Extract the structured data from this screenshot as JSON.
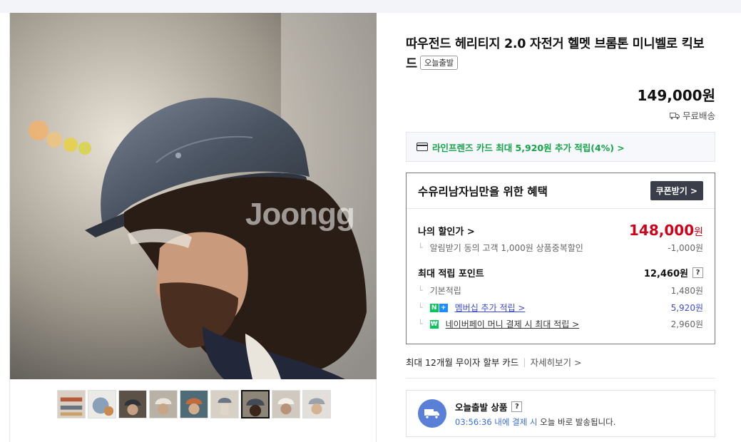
{
  "product": {
    "title": "따우전드 헤리티지 2.0 자전거 헬멧 브롬톤 미니벨로 킥보드",
    "badge": "오늘출발",
    "price": "149,000원",
    "shipping": "무료배송",
    "watermark": "Joongg"
  },
  "card_promo": {
    "text": "라인프렌즈 카드 최대 5,920원 추가 적립(4%) >"
  },
  "benefit": {
    "title": "수유리남자님만을 위한 혜택",
    "coupon_button": "쿠폰받기 >",
    "my_price_label": "나의 할인가 >",
    "my_price_value": "148,000",
    "won": "원",
    "coupon_desc": "알림받기 동의 고객 1,000원 상품중복할인",
    "coupon_amount": "-1,000원",
    "points_label": "최대 적립 포인트",
    "points_value": "12,460원",
    "help": "?",
    "base_label": "기본적립",
    "base_value": "1,480원",
    "membership_label": "멤버십 추가 적립 >",
    "membership_value": "5,920원",
    "npay_label": "네이버페이 머니 결제 시 최대 적립 >",
    "npay_value": "2,960원",
    "corner": "└"
  },
  "installment": {
    "text": "최대 12개월 무이자 할부 카드",
    "sep": "|",
    "more": "자세히보기 >"
  },
  "today_ship": {
    "title": "오늘출발 상품",
    "help": "?",
    "time": "03:56:36 내에 결제 시",
    "desc": " 오늘 바로 발송됩니다."
  },
  "thumbnails": [
    "thumb-1",
    "thumb-2",
    "thumb-3",
    "thumb-4",
    "thumb-5",
    "thumb-6",
    "thumb-7",
    "thumb-8",
    "thumb-9"
  ],
  "colors": {
    "accent_red": "#d0021b",
    "green": "#16a34a",
    "blue_link": "#3c4bd6",
    "coupon_bg": "#3a3d4a"
  }
}
